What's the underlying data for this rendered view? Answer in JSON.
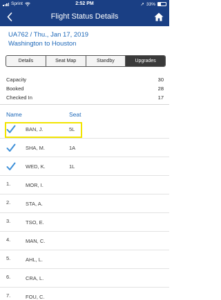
{
  "status_bar": {
    "carrier": "Sprint",
    "time": "2:52 PM",
    "battery": "33%"
  },
  "nav": {
    "title": "Flight Status Details",
    "back_icon": "chevron-left-icon",
    "home_icon": "home-icon"
  },
  "flight": {
    "line1": "UA762 / Thu., Jan 17, 2019",
    "line2": "Washington to Houston"
  },
  "tabs": [
    {
      "label": "Details",
      "active": false
    },
    {
      "label": "Seat Map",
      "active": false
    },
    {
      "label": "Standby",
      "active": false
    },
    {
      "label": "Upgrades",
      "active": true
    }
  ],
  "stats": [
    {
      "label": "Capacity",
      "value": "30"
    },
    {
      "label": "Booked",
      "value": "28"
    },
    {
      "label": "Checked In",
      "value": "17"
    }
  ],
  "list_header": {
    "name": "Name",
    "seat": "Seat"
  },
  "passengers": [
    {
      "mark": "check",
      "name": "BAN, J.",
      "seat": "5L"
    },
    {
      "mark": "check",
      "name": "SHA, M.",
      "seat": "1A"
    },
    {
      "mark": "check",
      "name": "WED, K.",
      "seat": "1L"
    },
    {
      "mark": "1.",
      "name": "MOR, I.",
      "seat": ""
    },
    {
      "mark": "2.",
      "name": "STA, A.",
      "seat": ""
    },
    {
      "mark": "3.",
      "name": "TSO, E.",
      "seat": ""
    },
    {
      "mark": "4.",
      "name": "MAN, C.",
      "seat": ""
    },
    {
      "mark": "5.",
      "name": "AHL, L.",
      "seat": ""
    },
    {
      "mark": "6.",
      "name": "CRA, L.",
      "seat": ""
    },
    {
      "mark": "7.",
      "name": "FOU, C.",
      "seat": ""
    }
  ],
  "colors": {
    "nav_bg": "#1a3f84",
    "link": "#1c67b8",
    "check": "#3d8fd8",
    "highlight": "#f2e400"
  }
}
